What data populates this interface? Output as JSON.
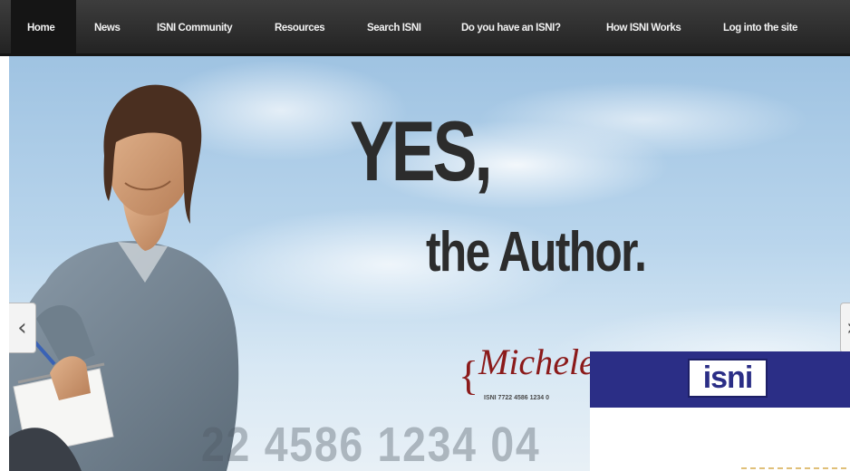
{
  "nav": {
    "items": [
      {
        "label": "Home"
      },
      {
        "label": "News"
      },
      {
        "label": "ISNI Community"
      },
      {
        "label": "Resources"
      },
      {
        "label": "Search ISNI"
      },
      {
        "label": "Do you have an ISNI?"
      },
      {
        "label": "How ISNI Works"
      },
      {
        "label": "Log into the site"
      }
    ]
  },
  "hero": {
    "headline": "YES,",
    "subheadline": "the Author.",
    "signature": "Michele",
    "signature_brace": "{",
    "signature_id": "ISNI 7722 4586 1234 0",
    "background_number": "22 4586 1234 04",
    "prev_icon": "chevron-left-icon",
    "next_icon": "chevron-right-icon"
  },
  "overlay": {
    "logo_text": "isni",
    "bar_color": "#2b2e86"
  }
}
